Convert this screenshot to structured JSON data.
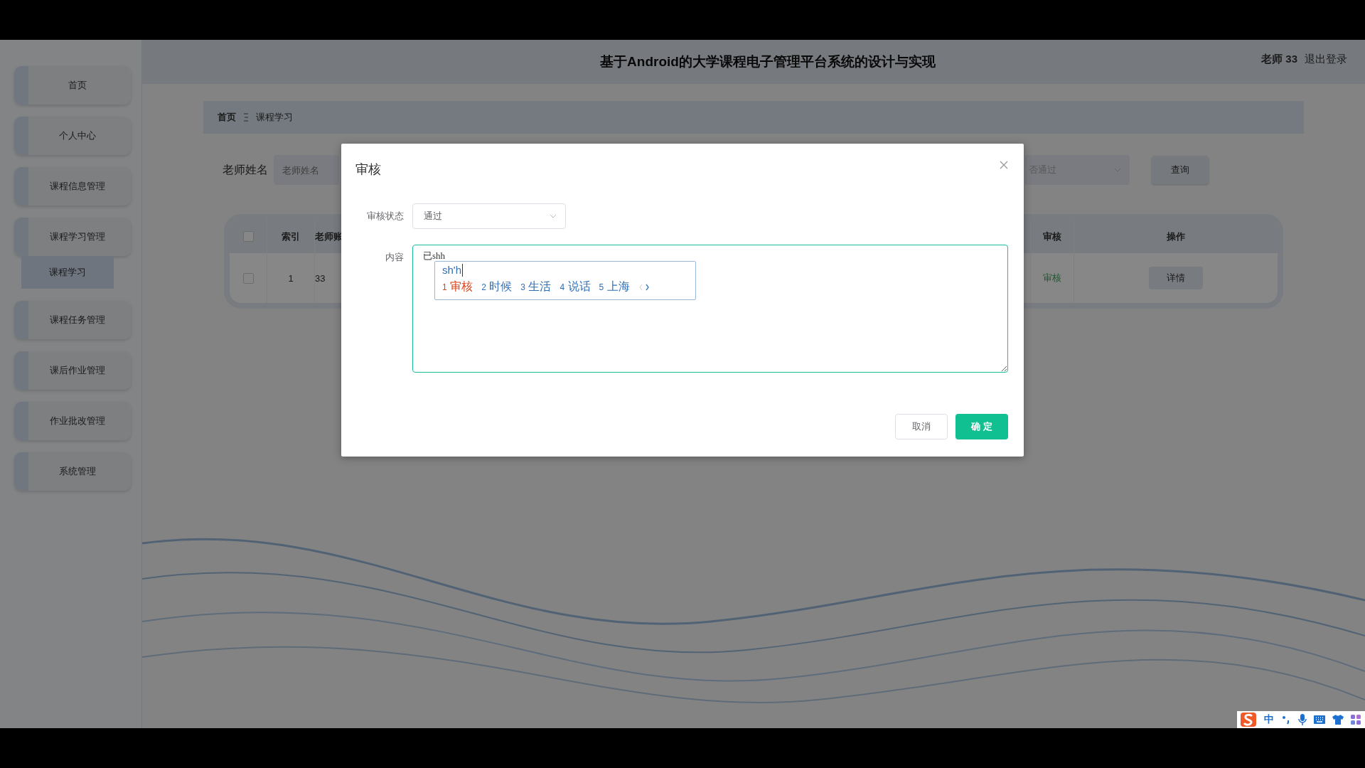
{
  "header": {
    "title": "基于Android的大学课程电子管理平台系统的设计与实现",
    "user": "老师 33",
    "logout": "退出登录"
  },
  "sidebar": {
    "items": [
      {
        "label": "首页",
        "selected": false
      },
      {
        "label": "个人中心",
        "selected": false
      },
      {
        "label": "课程信息管理",
        "selected": false
      },
      {
        "label": "课程学习管理",
        "selected": false,
        "children": [
          {
            "label": "课程学习",
            "selected": true
          }
        ]
      },
      {
        "label": "课程任务管理",
        "selected": false
      },
      {
        "label": "课后作业管理",
        "selected": false
      },
      {
        "label": "作业批改管理",
        "selected": false
      },
      {
        "label": "系统管理",
        "selected": false
      }
    ]
  },
  "breadcrumb": [
    "首页",
    "课程学习"
  ],
  "search": {
    "label": "老师姓名",
    "name_placeholder": "老师姓名",
    "status_placeholder": "否通过",
    "button": "查询"
  },
  "table": {
    "header_checked": false,
    "columns": [
      "索引",
      "老师账",
      "审核",
      "操作"
    ],
    "rows": [
      {
        "checked": false,
        "index": "1",
        "teacher": "33",
        "status": "审核",
        "action": "详情"
      }
    ]
  },
  "dialog": {
    "title": "审核",
    "status_label": "审核状态",
    "status_value": "通过",
    "content_label": "内容",
    "content_value": "已shh",
    "ime": {
      "composition": "sh'h",
      "candidates": [
        {
          "number": "1",
          "text": "审核",
          "selected": true
        },
        {
          "number": "2",
          "text": "时候",
          "selected": false
        },
        {
          "number": "3",
          "text": "生活",
          "selected": false
        },
        {
          "number": "4",
          "text": "说话",
          "selected": false
        },
        {
          "number": "5",
          "text": "上海",
          "selected": false
        }
      ]
    },
    "cancel": "取消",
    "confirm": "确 定"
  },
  "ime_toolbar": {
    "mode": "中"
  }
}
